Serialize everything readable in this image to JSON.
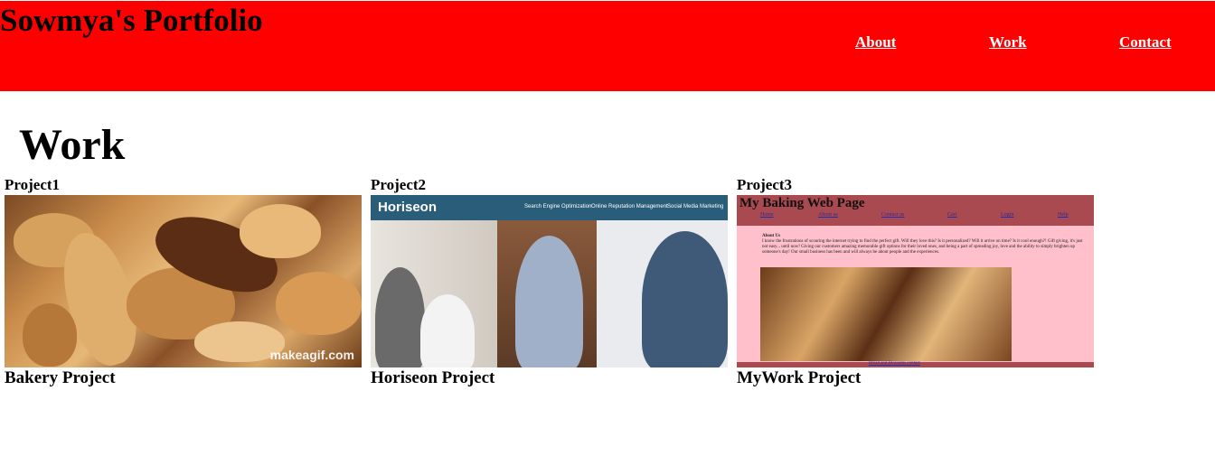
{
  "header": {
    "title": "Sowmya's Portfolio",
    "nav": {
      "about": "About",
      "work": "Work",
      "contact": "Contact"
    }
  },
  "main": {
    "section_title": "Work",
    "projects": [
      {
        "heading": "Project1",
        "name": "Bakery Project",
        "watermark": "makeagif.com"
      },
      {
        "heading": "Project2",
        "name": "Horiseon Project",
        "screenshot": {
          "logo": "Horiseon",
          "nav": [
            "Search Engine Optimization",
            "Online Reputation Management",
            "Social Media Marketing"
          ]
        }
      },
      {
        "heading": "Project3",
        "name": "MyWork Project",
        "screenshot": {
          "title": "My Baking Web Page",
          "links": [
            "Home",
            "About us",
            "Contact us",
            "Cart",
            "Login",
            "Help"
          ],
          "about_heading": "About Us",
          "about_text": "I know the frustrations of scouring the internet trying to find the perfect gift. Will they love this? Is it personalized? Will it arrive on time? Is it cool enough?! Gift giving, it's just not easy... until now! Giving our customers amazing memorable gift options for their loved ones, and being a part of spreading joy, love and the ability to simply brighten up someone's day! Our small business has been and will always be about people and the experiences.",
          "footer": "Bread and Blossoms contact"
        }
      }
    ]
  }
}
